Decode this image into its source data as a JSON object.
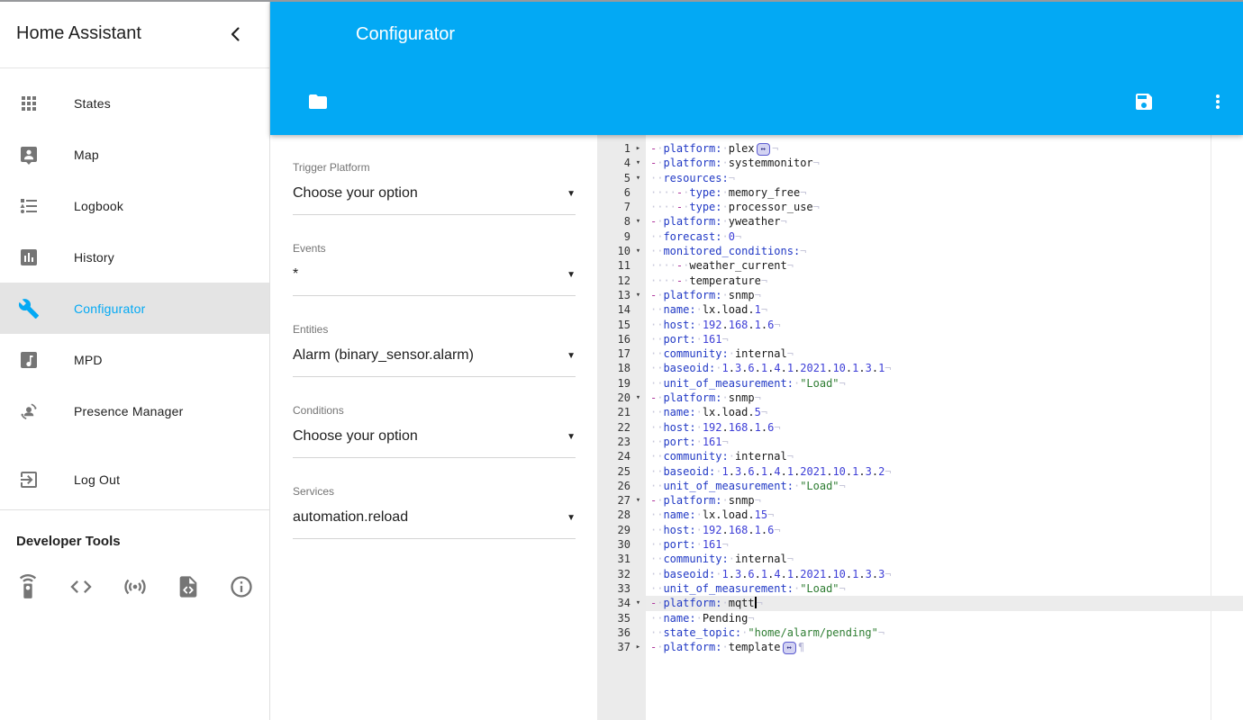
{
  "colors": {
    "accent": "#03a9f4",
    "sidebar_active_bg": "#e4e4e4",
    "gutter_bg": "#ebebeb",
    "active_line_bg": "#ececec",
    "code_key": "#2139c5",
    "code_number": "#3d3ed6",
    "code_string": "#2e7d32",
    "code_dash": "#b03a9e",
    "code_invisibles": "#c7c7da"
  },
  "sidebar": {
    "title": "Home Assistant",
    "collapse_icon": "chevron-left-icon",
    "items": [
      {
        "label": "States",
        "icon": "apps-icon"
      },
      {
        "label": "Map",
        "icon": "map-account-icon"
      },
      {
        "label": "Logbook",
        "icon": "list-bulleted-icon"
      },
      {
        "label": "History",
        "icon": "chart-box-icon"
      },
      {
        "label": "Configurator",
        "icon": "wrench-icon",
        "active": true
      },
      {
        "label": "MPD",
        "icon": "music-box-icon"
      },
      {
        "label": "Presence Manager",
        "icon": "account-sync-icon"
      },
      {
        "label": "Log Out",
        "icon": "exit-icon",
        "gap_before": true
      }
    ],
    "dev_tools": {
      "label": "Developer Tools",
      "icons": [
        "remote-icon",
        "code-tags-icon",
        "access-point-icon",
        "file-code-icon",
        "info-icon"
      ]
    }
  },
  "header": {
    "title": "Configurator",
    "toolbar": {
      "left_icons": [
        "folder-icon"
      ],
      "right_icons": [
        "save-icon",
        "kebab-icon"
      ]
    }
  },
  "form": {
    "fields": [
      {
        "label": "Trigger Platform",
        "value": "Choose your option"
      },
      {
        "label": "Events",
        "value": "*"
      },
      {
        "label": "Entities",
        "value": "Alarm (binary_sensor.alarm)"
      },
      {
        "label": "Conditions",
        "value": "Choose your option"
      },
      {
        "label": "Services",
        "value": "automation.reload"
      }
    ]
  },
  "editor": {
    "lines": [
      {
        "n": 1,
        "fold": "collapsed",
        "tokens": [
          [
            "d"
          ],
          [
            "sp",
            1
          ],
          [
            "k",
            "platform:"
          ],
          [
            "sp",
            1
          ],
          [
            "t",
            "plex"
          ],
          [
            "fold"
          ],
          [
            "eol"
          ]
        ]
      },
      {
        "n": 4,
        "fold": "open",
        "tokens": [
          [
            "d"
          ],
          [
            "sp",
            1
          ],
          [
            "k",
            "platform:"
          ],
          [
            "sp",
            1
          ],
          [
            "t",
            "systemmonitor"
          ],
          [
            "eol"
          ]
        ]
      },
      {
        "n": 5,
        "fold": "open",
        "tokens": [
          [
            "sp",
            2
          ],
          [
            "k",
            "resources:"
          ],
          [
            "eol"
          ]
        ]
      },
      {
        "n": 6,
        "tokens": [
          [
            "sp",
            4
          ],
          [
            "d"
          ],
          [
            "sp",
            1
          ],
          [
            "k",
            "type:"
          ],
          [
            "sp",
            1
          ],
          [
            "t",
            "memory_free"
          ],
          [
            "eol"
          ]
        ]
      },
      {
        "n": 7,
        "tokens": [
          [
            "sp",
            4
          ],
          [
            "d"
          ],
          [
            "sp",
            1
          ],
          [
            "k",
            "type:"
          ],
          [
            "sp",
            1
          ],
          [
            "t",
            "processor_use"
          ],
          [
            "eol"
          ]
        ]
      },
      {
        "n": 8,
        "fold": "open",
        "tokens": [
          [
            "d"
          ],
          [
            "sp",
            1
          ],
          [
            "k",
            "platform:"
          ],
          [
            "sp",
            1
          ],
          [
            "t",
            "yweather"
          ],
          [
            "eol"
          ]
        ]
      },
      {
        "n": 9,
        "tokens": [
          [
            "sp",
            2
          ],
          [
            "k",
            "forecast:"
          ],
          [
            "sp",
            1
          ],
          [
            "n",
            "0"
          ],
          [
            "eol"
          ]
        ]
      },
      {
        "n": 10,
        "fold": "open",
        "tokens": [
          [
            "sp",
            2
          ],
          [
            "k",
            "monitored_conditions:"
          ],
          [
            "eol"
          ]
        ]
      },
      {
        "n": 11,
        "tokens": [
          [
            "sp",
            4
          ],
          [
            "d"
          ],
          [
            "sp",
            1
          ],
          [
            "t",
            "weather_current"
          ],
          [
            "eol"
          ]
        ]
      },
      {
        "n": 12,
        "tokens": [
          [
            "sp",
            4
          ],
          [
            "d"
          ],
          [
            "sp",
            1
          ],
          [
            "t",
            "temperature"
          ],
          [
            "eol"
          ]
        ]
      },
      {
        "n": 13,
        "fold": "open",
        "tokens": [
          [
            "d"
          ],
          [
            "sp",
            1
          ],
          [
            "k",
            "platform:"
          ],
          [
            "sp",
            1
          ],
          [
            "t",
            "snmp"
          ],
          [
            "eol"
          ]
        ]
      },
      {
        "n": 14,
        "tokens": [
          [
            "sp",
            2
          ],
          [
            "k",
            "name:"
          ],
          [
            "sp",
            1
          ],
          [
            "t",
            "lx.load."
          ],
          [
            "n",
            "1"
          ],
          [
            "eol"
          ]
        ]
      },
      {
        "n": 15,
        "tokens": [
          [
            "sp",
            2
          ],
          [
            "k",
            "host:"
          ],
          [
            "sp",
            1
          ],
          [
            "dn",
            "192.168.1.6"
          ],
          [
            "eol"
          ]
        ]
      },
      {
        "n": 16,
        "tokens": [
          [
            "sp",
            2
          ],
          [
            "k",
            "port:"
          ],
          [
            "sp",
            1
          ],
          [
            "n",
            "161"
          ],
          [
            "eol"
          ]
        ]
      },
      {
        "n": 17,
        "tokens": [
          [
            "sp",
            2
          ],
          [
            "k",
            "community:"
          ],
          [
            "sp",
            1
          ],
          [
            "t",
            "internal"
          ],
          [
            "eol"
          ]
        ]
      },
      {
        "n": 18,
        "tokens": [
          [
            "sp",
            2
          ],
          [
            "k",
            "baseoid:"
          ],
          [
            "sp",
            1
          ],
          [
            "dn",
            "1.3.6.1.4.1.2021.10.1.3.1"
          ],
          [
            "eol"
          ]
        ]
      },
      {
        "n": 19,
        "tokens": [
          [
            "sp",
            2
          ],
          [
            "k",
            "unit_of_measurement:"
          ],
          [
            "sp",
            1
          ],
          [
            "s",
            "\"Load\""
          ],
          [
            "eol"
          ]
        ]
      },
      {
        "n": 20,
        "fold": "open",
        "tokens": [
          [
            "d"
          ],
          [
            "sp",
            1
          ],
          [
            "k",
            "platform:"
          ],
          [
            "sp",
            1
          ],
          [
            "t",
            "snmp"
          ],
          [
            "eol"
          ]
        ]
      },
      {
        "n": 21,
        "tokens": [
          [
            "sp",
            2
          ],
          [
            "k",
            "name:"
          ],
          [
            "sp",
            1
          ],
          [
            "t",
            "lx.load."
          ],
          [
            "n",
            "5"
          ],
          [
            "eol"
          ]
        ]
      },
      {
        "n": 22,
        "tokens": [
          [
            "sp",
            2
          ],
          [
            "k",
            "host:"
          ],
          [
            "sp",
            1
          ],
          [
            "dn",
            "192.168.1.6"
          ],
          [
            "eol"
          ]
        ]
      },
      {
        "n": 23,
        "tokens": [
          [
            "sp",
            2
          ],
          [
            "k",
            "port:"
          ],
          [
            "sp",
            1
          ],
          [
            "n",
            "161"
          ],
          [
            "eol"
          ]
        ]
      },
      {
        "n": 24,
        "tokens": [
          [
            "sp",
            2
          ],
          [
            "k",
            "community:"
          ],
          [
            "sp",
            1
          ],
          [
            "t",
            "internal"
          ],
          [
            "eol"
          ]
        ]
      },
      {
        "n": 25,
        "tokens": [
          [
            "sp",
            2
          ],
          [
            "k",
            "baseoid:"
          ],
          [
            "sp",
            1
          ],
          [
            "dn",
            "1.3.6.1.4.1.2021.10.1.3.2"
          ],
          [
            "eol"
          ]
        ]
      },
      {
        "n": 26,
        "tokens": [
          [
            "sp",
            2
          ],
          [
            "k",
            "unit_of_measurement:"
          ],
          [
            "sp",
            1
          ],
          [
            "s",
            "\"Load\""
          ],
          [
            "eol"
          ]
        ]
      },
      {
        "n": 27,
        "fold": "open",
        "tokens": [
          [
            "d"
          ],
          [
            "sp",
            1
          ],
          [
            "k",
            "platform:"
          ],
          [
            "sp",
            1
          ],
          [
            "t",
            "snmp"
          ],
          [
            "eol"
          ]
        ]
      },
      {
        "n": 28,
        "tokens": [
          [
            "sp",
            2
          ],
          [
            "k",
            "name:"
          ],
          [
            "sp",
            1
          ],
          [
            "t",
            "lx.load."
          ],
          [
            "n",
            "15"
          ],
          [
            "eol"
          ]
        ]
      },
      {
        "n": 29,
        "tokens": [
          [
            "sp",
            2
          ],
          [
            "k",
            "host:"
          ],
          [
            "sp",
            1
          ],
          [
            "dn",
            "192.168.1.6"
          ],
          [
            "eol"
          ]
        ]
      },
      {
        "n": 30,
        "tokens": [
          [
            "sp",
            2
          ],
          [
            "k",
            "port:"
          ],
          [
            "sp",
            1
          ],
          [
            "n",
            "161"
          ],
          [
            "eol"
          ]
        ]
      },
      {
        "n": 31,
        "tokens": [
          [
            "sp",
            2
          ],
          [
            "k",
            "community:"
          ],
          [
            "sp",
            1
          ],
          [
            "t",
            "internal"
          ],
          [
            "eol"
          ]
        ]
      },
      {
        "n": 32,
        "tokens": [
          [
            "sp",
            2
          ],
          [
            "k",
            "baseoid:"
          ],
          [
            "sp",
            1
          ],
          [
            "dn",
            "1.3.6.1.4.1.2021.10.1.3.3"
          ],
          [
            "eol"
          ]
        ]
      },
      {
        "n": 33,
        "tokens": [
          [
            "sp",
            2
          ],
          [
            "k",
            "unit_of_measurement:"
          ],
          [
            "sp",
            1
          ],
          [
            "s",
            "\"Load\""
          ],
          [
            "eol"
          ]
        ]
      },
      {
        "n": 34,
        "fold": "open",
        "active": true,
        "tokens": [
          [
            "d"
          ],
          [
            "sp",
            1
          ],
          [
            "k",
            "platform:"
          ],
          [
            "sp",
            1
          ],
          [
            "t",
            "mqtt"
          ],
          [
            "caret"
          ],
          [
            "eol"
          ]
        ]
      },
      {
        "n": 35,
        "tokens": [
          [
            "sp",
            2
          ],
          [
            "k",
            "name:"
          ],
          [
            "sp",
            1
          ],
          [
            "t",
            "Pending"
          ],
          [
            "eol"
          ]
        ]
      },
      {
        "n": 36,
        "tokens": [
          [
            "sp",
            2
          ],
          [
            "k",
            "state_topic:"
          ],
          [
            "sp",
            1
          ],
          [
            "s",
            "\"home/alarm/pending\""
          ],
          [
            "eol"
          ]
        ]
      },
      {
        "n": 37,
        "fold": "collapsed",
        "tokens": [
          [
            "d"
          ],
          [
            "sp",
            1
          ],
          [
            "k",
            "platform:"
          ],
          [
            "sp",
            1
          ],
          [
            "t",
            "template"
          ],
          [
            "fold"
          ],
          [
            "eof"
          ]
        ]
      }
    ]
  }
}
